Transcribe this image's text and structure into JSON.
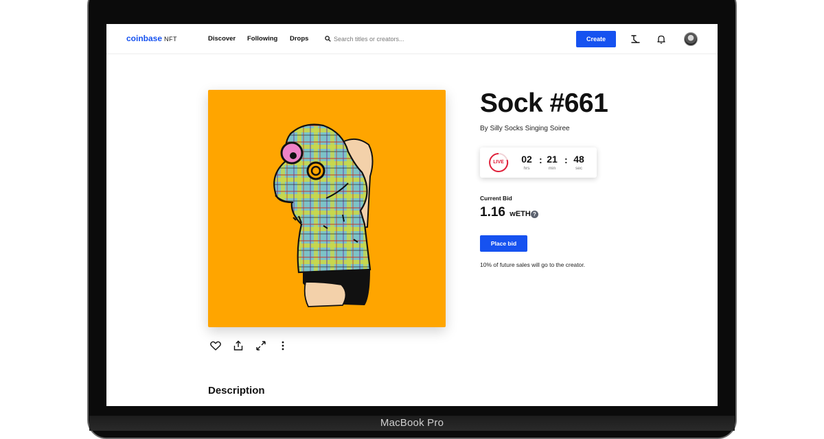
{
  "device": {
    "label": "MacBook Pro"
  },
  "nav": {
    "brand": "coinbase",
    "brand_suffix": "NFT",
    "links": [
      "Discover",
      "Following",
      "Drops"
    ],
    "search_placeholder": "Search titles or creators...",
    "create_label": "Create",
    "icons": [
      "gavel-icon",
      "bell-icon"
    ]
  },
  "artwork": {
    "background_color": "#ffa500",
    "actions": [
      "heart-icon",
      "share-icon",
      "expand-icon",
      "more-icon"
    ]
  },
  "item": {
    "title": "Sock #661",
    "byline": "By Silly Socks Singing Soiree"
  },
  "timer": {
    "live_label": "LIVE",
    "hours": "02",
    "hours_label": "hrs",
    "minutes": "21",
    "minutes_label": "min",
    "seconds": "48",
    "seconds_label": "sec",
    "separator": ":"
  },
  "bid": {
    "label": "Current Bid",
    "amount": "1.16",
    "currency": "wETH",
    "help": "?",
    "button_label": "Place bid",
    "royalty_note": "10% of future sales will go to the creator."
  },
  "description": {
    "heading": "Description"
  },
  "colors": {
    "brand": "#1652f0",
    "live": "#e0203a",
    "art_bg": "#ffa500"
  }
}
